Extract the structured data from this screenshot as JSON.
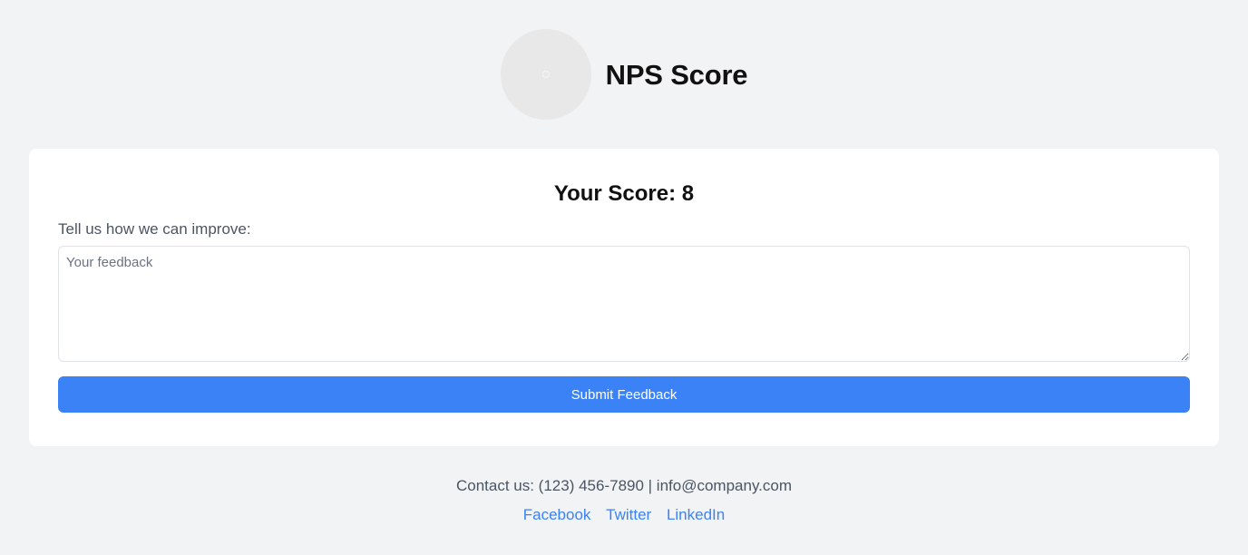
{
  "header": {
    "title": "NPS Score"
  },
  "card": {
    "score_text": "Your Score: 8",
    "improve_label": "Tell us how we can improve:",
    "feedback_value": "",
    "feedback_placeholder": "Your feedback",
    "submit_label": "Submit Feedback"
  },
  "footer": {
    "contact_text": "Contact us: (123) 456-7890 | info@company.com",
    "links": [
      {
        "label": "Facebook"
      },
      {
        "label": "Twitter"
      },
      {
        "label": "LinkedIn"
      }
    ]
  },
  "colors": {
    "page_background": "#f2f3f5",
    "card_background": "#ffffff",
    "accent": "#3b82f6",
    "muted_text": "#4b5563",
    "logo_placeholder": "#e8e8e8"
  },
  "icons": {
    "logo": "logo-placeholder-icon"
  }
}
